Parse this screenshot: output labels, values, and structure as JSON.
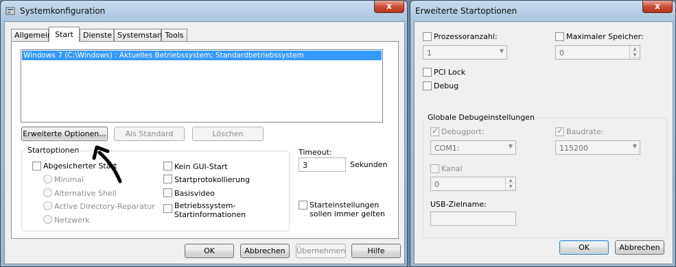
{
  "sysconfig": {
    "title": "Systemkonfiguration",
    "close_label": "x",
    "tabs": [
      {
        "label": "Allgemein"
      },
      {
        "label": "Start"
      },
      {
        "label": "Dienste"
      },
      {
        "label": "Systemstart"
      },
      {
        "label": "Tools"
      }
    ],
    "boot_entry": "Windows 7 (C:\\Windows) : Aktuelles Betriebssystem; Standardbetriebssystem",
    "buttons": {
      "advanced": "Erweiterte Optionen...",
      "set_default": "Als Standard",
      "delete": "Löschen",
      "ok": "OK",
      "cancel": "Abbrechen",
      "apply": "Übernehmen",
      "help": "Hilfe"
    },
    "boot_options": {
      "group_label": "Startoptionen",
      "safe_boot": "Abgesicherter Start",
      "minimal": "Minimal",
      "alternate_shell": "Alternative Shell",
      "ad_repair": "Active Directory-Reparatur",
      "network": "Netzwerk",
      "no_gui": "Kein GUI-Start",
      "boot_log": "Startprotokollierung",
      "base_video": "Basisvideo",
      "os_boot_info": "Betriebssystem-Startinformationen"
    },
    "timeout": {
      "label": "Timeout:",
      "value": "3",
      "unit": "Sekunden"
    },
    "make_permanent": "Starteinstellungen sollen immer gelten"
  },
  "advanced": {
    "title": "Erweiterte Startoptionen",
    "close_label": "x",
    "num_proc_label": "Prozessoranzahl:",
    "num_proc_value": "1",
    "max_mem_label": "Maximaler Speicher:",
    "max_mem_value": "0",
    "pci_lock": "PCI Lock",
    "debug": "Debug",
    "debug_group": "Globale Debugeinstellungen",
    "debug_port_label": "Debugport:",
    "debug_port_value": "COM1:",
    "baud_label": "Baudrate:",
    "baud_value": "115200",
    "channel_label": "Kanal",
    "channel_value": "0",
    "usb_label": "USB-Zielname:",
    "usb_value": "",
    "ok": "OK",
    "cancel": "Abbrechen"
  }
}
